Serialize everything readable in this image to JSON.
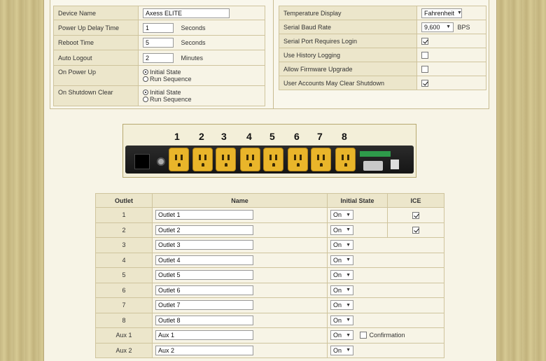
{
  "settings_left": [
    {
      "label": "Device Name",
      "type": "text",
      "value": "Axess ELITE"
    },
    {
      "label": "Power Up Delay Time",
      "type": "text-unit",
      "value": "1",
      "unit": "Seconds"
    },
    {
      "label": "Reboot Time",
      "type": "text-unit",
      "value": "5",
      "unit": "Seconds"
    },
    {
      "label": "Auto Logout",
      "type": "text-unit",
      "value": "2",
      "unit": "Minutes"
    },
    {
      "label": "On Power Up",
      "type": "radio",
      "options": [
        "Initial State",
        "Run Sequence"
      ],
      "selected": "Initial State"
    },
    {
      "label": "On Shutdown Clear",
      "type": "radio",
      "options": [
        "Initial State",
        "Run Sequence"
      ],
      "selected": "Initial State"
    }
  ],
  "settings_right": [
    {
      "label": "Temperature Display",
      "type": "select",
      "value": "Fahrenheit"
    },
    {
      "label": "Serial Baud Rate",
      "type": "select-unit",
      "value": "9,600",
      "unit": "BPS"
    },
    {
      "label": "Serial Port Requires Login",
      "type": "checkbox",
      "checked": true
    },
    {
      "label": "Use History Logging",
      "type": "checkbox",
      "checked": false
    },
    {
      "label": "Allow Firmware Upgrade",
      "type": "checkbox",
      "checked": false
    },
    {
      "label": "User Accounts May Clear Shutdown",
      "type": "checkbox",
      "checked": true
    }
  ],
  "device": {
    "outlet_numbers": [
      "1",
      "2",
      "3",
      "4",
      "5",
      "6",
      "7",
      "8"
    ]
  },
  "outlets_table": {
    "headers": {
      "outlet": "Outlet",
      "name": "Name",
      "initial_state": "Initial State",
      "ice": "ICE"
    },
    "rows": [
      {
        "outlet": "1",
        "name": "Outlet 1",
        "state": "On",
        "ice": true
      },
      {
        "outlet": "2",
        "name": "Outlet 2",
        "state": "On",
        "ice": true
      },
      {
        "outlet": "3",
        "name": "Outlet 3",
        "state": "On"
      },
      {
        "outlet": "4",
        "name": "Outlet 4",
        "state": "On"
      },
      {
        "outlet": "5",
        "name": "Outlet 5",
        "state": "On"
      },
      {
        "outlet": "6",
        "name": "Outlet 6",
        "state": "On"
      },
      {
        "outlet": "7",
        "name": "Outlet 7",
        "state": "On"
      },
      {
        "outlet": "8",
        "name": "Outlet 8",
        "state": "On"
      },
      {
        "outlet": "Aux 1",
        "name": "Aux 1",
        "state": "On",
        "confirmation_label": "Confirmation",
        "confirmation": false
      },
      {
        "outlet": "Aux 2",
        "name": "Aux 2",
        "state": "On"
      }
    ]
  },
  "colors": {
    "panel_bg": "#f7f4e6",
    "label_bg": "#ece6cb",
    "border": "#cfc49d",
    "outlet_yellow": "#e9b52a"
  }
}
